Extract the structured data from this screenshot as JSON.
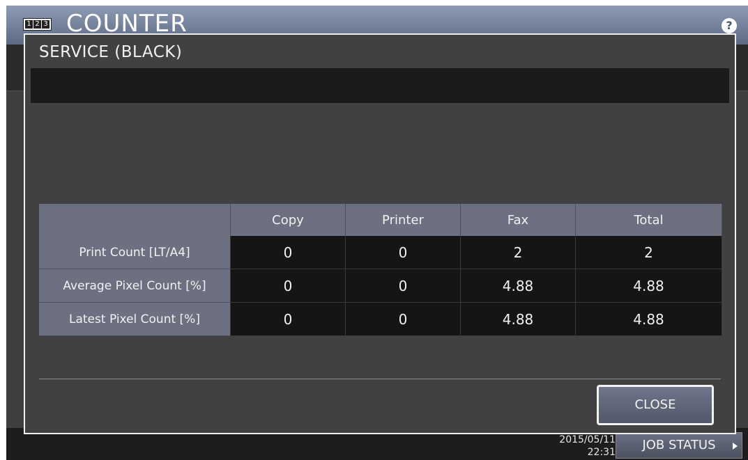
{
  "app": {
    "title": "COUNTER",
    "counter_icon_digits": [
      "1",
      "2",
      "3"
    ],
    "help_symbol": "?"
  },
  "footer": {
    "date": "2015/05/11",
    "time": "22:31",
    "job_status_label": "JOB STATUS"
  },
  "dialog": {
    "title": "SERVICE (BLACK)",
    "columns": [
      "",
      "Copy",
      "Printer",
      "Fax",
      "Total"
    ],
    "rows": [
      {
        "label": "Print Count [LT/A4]",
        "values": [
          "0",
          "0",
          "2",
          "2"
        ]
      },
      {
        "label": "Average Pixel Count [%]",
        "values": [
          "0",
          "0",
          "4.88",
          "4.88"
        ]
      },
      {
        "label": "Latest Pixel Count [%]",
        "values": [
          "0",
          "0",
          "4.88",
          "4.88"
        ]
      }
    ],
    "close_label": "CLOSE"
  },
  "colors": {
    "header_cell": "#6c7080",
    "data_cell": "#151515",
    "dialog_bg": "#414143"
  }
}
